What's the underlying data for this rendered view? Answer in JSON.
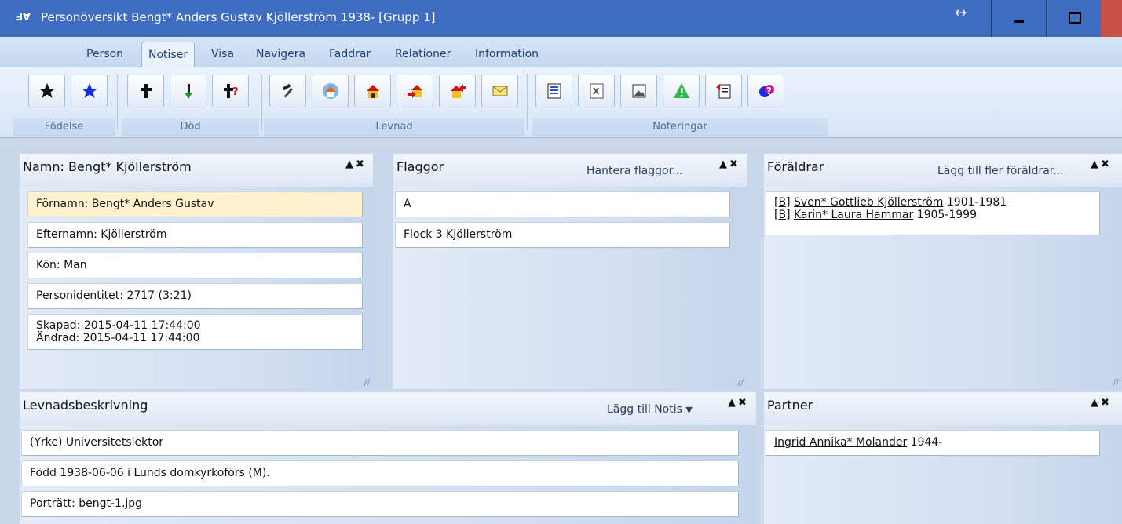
{
  "window": {
    "title": "Personöversikt Bengt* Anders Gustav Kjöllerström 1938- [Grupp 1]",
    "app_icon": "ℲⱯ",
    "resize_glyph": "↔"
  },
  "ribbon": {
    "tabs": [
      "Person",
      "Notiser",
      "Visa",
      "Navigera",
      "Faddrar",
      "Relationer",
      "Information"
    ],
    "active_tab": "Notiser",
    "groups": {
      "fodelse": "Födelse",
      "dod": "Död",
      "levnad": "Levnad",
      "noteringar": "Noteringar"
    }
  },
  "panels": {
    "namn": {
      "title": "Namn: Bengt* Kjöllerström",
      "controls": "▲✖",
      "fornamn": "Förnamn: Bengt* Anders Gustav",
      "efternamn": "Efternamn: Kjöllerström",
      "kon": "Kön: Man",
      "personidentitet": "Personidentitet: 2717 (3:21)",
      "skapad": "Skapad: 2015-04-11 17:44:00",
      "andrad": "Ändrad: 2015-04-11 17:44:00"
    },
    "flaggor": {
      "title": "Flaggor",
      "link": "Hantera flaggor...",
      "controls": "▲✖",
      "items": [
        "A",
        "Flock 3 Kjöllerström"
      ]
    },
    "foraldrar": {
      "title": "Föräldrar",
      "link": "Lägg till fler föräldrar...",
      "controls": "▲✖",
      "parents": [
        {
          "tag": "[B]",
          "name": "Sven* Gottlieb Kjöllerström",
          "years": "1901-1981"
        },
        {
          "tag": "[B]",
          "name": "Karin* Laura Hammar",
          "years": "1905-1999"
        }
      ]
    },
    "levnadsbeskrivning": {
      "title": "Levnadsbeskrivning",
      "link": "Lägg till Notis",
      "controls": "▲✖",
      "items": [
        "(Yrke) Universitetslektor",
        "Född 1938-06-06 i Lunds domkyrkoförs (M).",
        "Porträtt: bengt-1.jpg"
      ]
    },
    "partner": {
      "title": "Partner",
      "controls": "▲✖",
      "name": "Ingrid Annika* Molander",
      "years": "1944-"
    }
  },
  "colors": {
    "titlebar": "#3f6ec1",
    "selected_row": "#fdf2cd",
    "warning_icon": "#2db84a",
    "close_button": "#c8524a"
  }
}
